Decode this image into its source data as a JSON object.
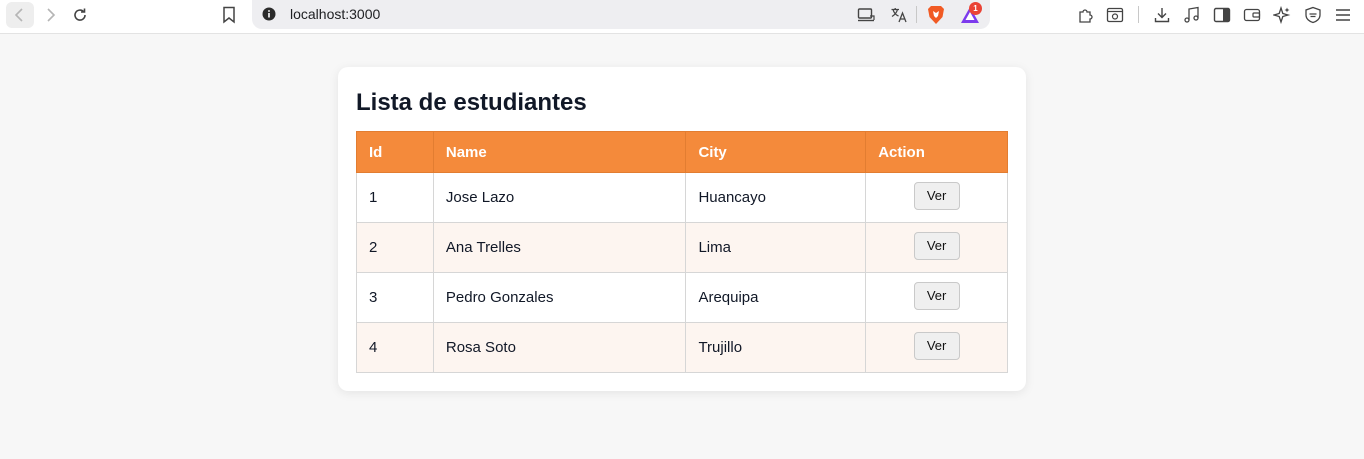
{
  "browser": {
    "url": "localhost:3000",
    "rewards_badge": "1",
    "icons": {
      "back": "chevron-left-icon",
      "forward": "chevron-right-icon",
      "reload": "reload-icon",
      "bookmark": "bookmark-icon",
      "site_info": "info-icon",
      "cast": "cast-icon",
      "translate": "translate-icon",
      "brave": "brave-shield-icon",
      "rewards": "brave-rewards-icon",
      "right": [
        "extensions-icon",
        "screenshot-icon",
        "download-icon",
        "music-icon",
        "sidebar-icon",
        "wallet-icon",
        "leo-ai-icon",
        "vpn-icon",
        "menu-icon"
      ]
    }
  },
  "page": {
    "title": "Lista de estudiantes",
    "table": {
      "headers": [
        "Id",
        "Name",
        "City",
        "Action"
      ],
      "rows": [
        {
          "id": "1",
          "name": "Jose Lazo",
          "city": "Huancayo",
          "action": "Ver"
        },
        {
          "id": "2",
          "name": "Ana Trelles",
          "city": "Lima",
          "action": "Ver"
        },
        {
          "id": "3",
          "name": "Pedro Gonzales",
          "city": "Arequipa",
          "action": "Ver"
        },
        {
          "id": "4",
          "name": "Rosa Soto",
          "city": "Trujillo",
          "action": "Ver"
        }
      ]
    }
  },
  "colors": {
    "header_bg": "#f48a3b",
    "stripe_bg": "#fdf5f0",
    "page_bg": "#f7f7f7"
  }
}
